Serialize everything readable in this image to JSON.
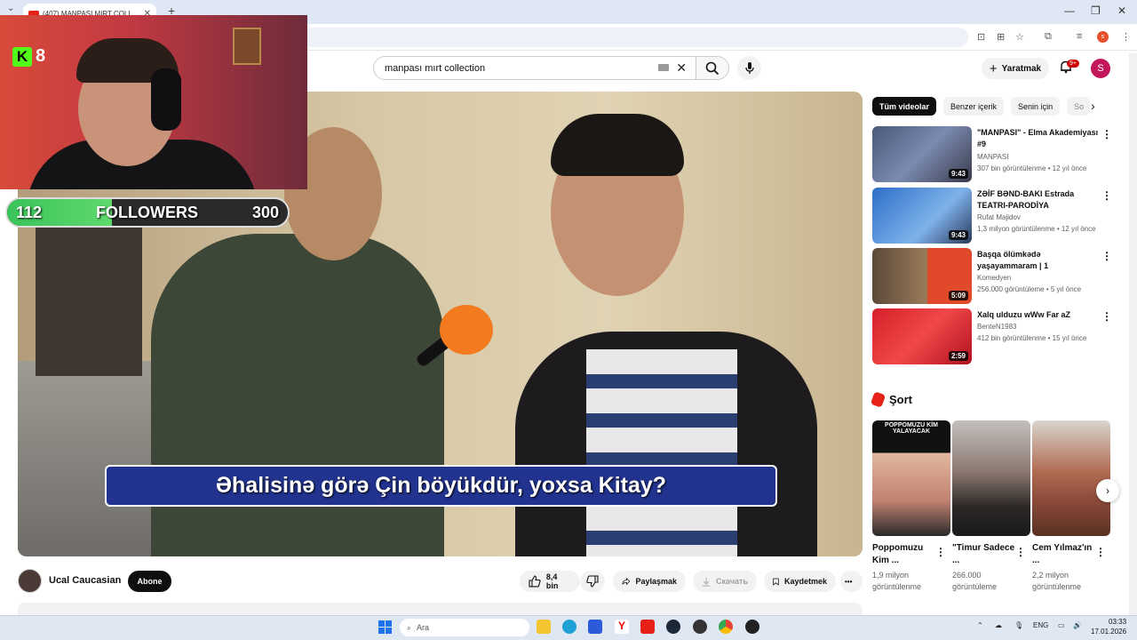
{
  "browser": {
    "tab_title": "(407) MANPASI MIRT COLL",
    "tab_close": "✕",
    "new_tab": "+",
    "tab_menu": "⌄",
    "win_minimize": "—",
    "win_restore": "❐",
    "win_close": "✕",
    "profile_initial": "s"
  },
  "header": {
    "search_value": "manpası mırt collection",
    "search_clear": "✕",
    "search_button": "⌕",
    "mic": "🎙",
    "create_label": "Yaratmak",
    "create_plus": "+",
    "bell": "🔔",
    "notif_badge": "9+",
    "avatar_initial": "S"
  },
  "video": {
    "subtitle": "Əhalisinə görə Çin böyükdür, yoxsa Kitay?"
  },
  "overlay": {
    "kick_letter": "K",
    "kick_viewers": "8",
    "followers_current": "112",
    "followers_label": "FOLLOWERS",
    "followers_goal": "300",
    "followers_progress": 0.373
  },
  "below_video": {
    "channel_name": "Ucal Caucasian",
    "subscribe_label": "Abone",
    "like_count": "8,4 bin",
    "share_label": "Paylaşmak",
    "download_label": "Скачать",
    "save_label": "Kaydetmek",
    "more": "•••"
  },
  "sidebar": {
    "chips": [
      "Tüm videolar",
      "Benzer içerik",
      "Senin için",
      "So"
    ],
    "chip_next": "›",
    "recommendations": [
      {
        "title": "\"MANPASI\" - Elma Akademiyası #9",
        "channel": "MANPASI",
        "meta": "307 bin görüntülenme • 12 yıl önce",
        "duration": "9:43"
      },
      {
        "title": "ZƏİF BƏND-BAKI Estrada TEATRI-PARODİYA",
        "channel": "Rufat Majidov",
        "meta": "1,3 milyon görüntülenme • 12 yıl önce",
        "duration": "9:43"
      },
      {
        "title": "Başqa ölümkədə yaşayammaram | 1",
        "channel": "Komedyen",
        "meta": "256.000 görüntüleme • 5 yıl önce",
        "duration": "5:09"
      },
      {
        "title": "Xalq ulduzu wWw Far aZ",
        "channel": "BenteN1983",
        "meta": "412 bin görüntülenme • 15 yıl önce",
        "duration": "2:59"
      }
    ],
    "shorts_title": "Şort",
    "shorts": [
      {
        "title": "Poppomuzu Kim ...",
        "meta": "1,9 milyon görüntülenme",
        "caption": "POPPOMUZU KİM YALAYACAK"
      },
      {
        "title": "\"Timur Sadece ...",
        "meta": "266.000 görüntüleme",
        "caption": ""
      },
      {
        "title": "Cem Yılmaz'ın ...",
        "meta": "2,2 milyon görüntülenme",
        "caption": ""
      }
    ],
    "shorts_next": "›"
  },
  "taskbar": {
    "search_placeholder": "Ara",
    "lang": "ENG",
    "time": "03:33",
    "date": "17.01.2026"
  }
}
